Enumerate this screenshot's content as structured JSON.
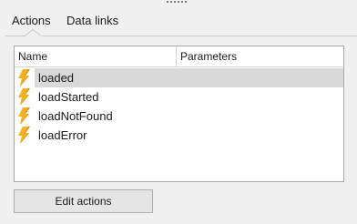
{
  "tabs": [
    {
      "label": "Actions",
      "active": true
    },
    {
      "label": "Data links",
      "active": false
    }
  ],
  "table": {
    "columns": [
      "Name",
      "Parameters"
    ],
    "rows": [
      {
        "name": "loaded",
        "parameters": "",
        "selected": true,
        "icon": "lightning-icon"
      },
      {
        "name": "loadStarted",
        "parameters": "",
        "selected": false,
        "icon": "lightning-icon"
      },
      {
        "name": "loadNotFound",
        "parameters": "",
        "selected": false,
        "icon": "lightning-icon"
      },
      {
        "name": "loadError",
        "parameters": "",
        "selected": false,
        "icon": "lightning-icon"
      }
    ]
  },
  "buttons": {
    "edit_actions_label": "Edit actions"
  },
  "colors": {
    "icon_fill": "#f5b21a",
    "icon_shadow": "#e08a00",
    "selection": "#d9d9d9",
    "background": "#f0f0f0"
  }
}
